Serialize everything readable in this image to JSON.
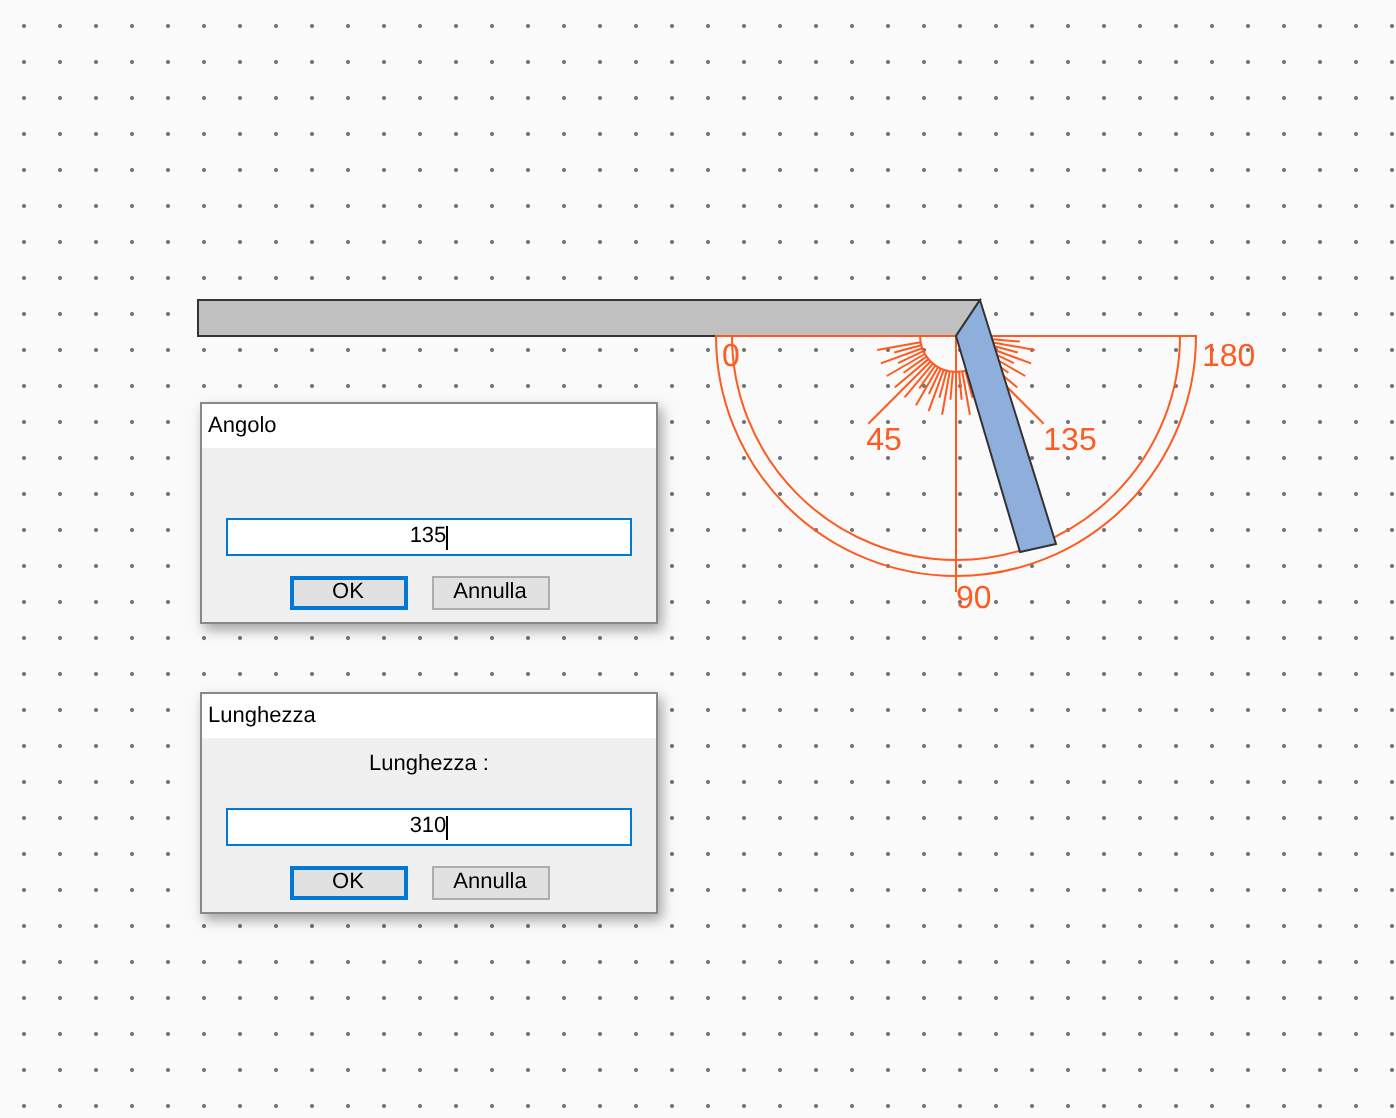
{
  "protractor": {
    "labels": [
      "0",
      "45",
      "90",
      "135",
      "180"
    ]
  },
  "dialogs": [
    {
      "title": "Angolo",
      "value": "135",
      "buttons": [
        {
          "label": "OK",
          "default": true
        },
        {
          "label": "Annulla",
          "default": false
        }
      ]
    },
    {
      "title": "Lunghezza",
      "prompt": "Lunghezza :",
      "value": "310",
      "buttons": [
        {
          "label": "OK",
          "default": true
        },
        {
          "label": "Annulla",
          "default": false
        }
      ]
    }
  ]
}
